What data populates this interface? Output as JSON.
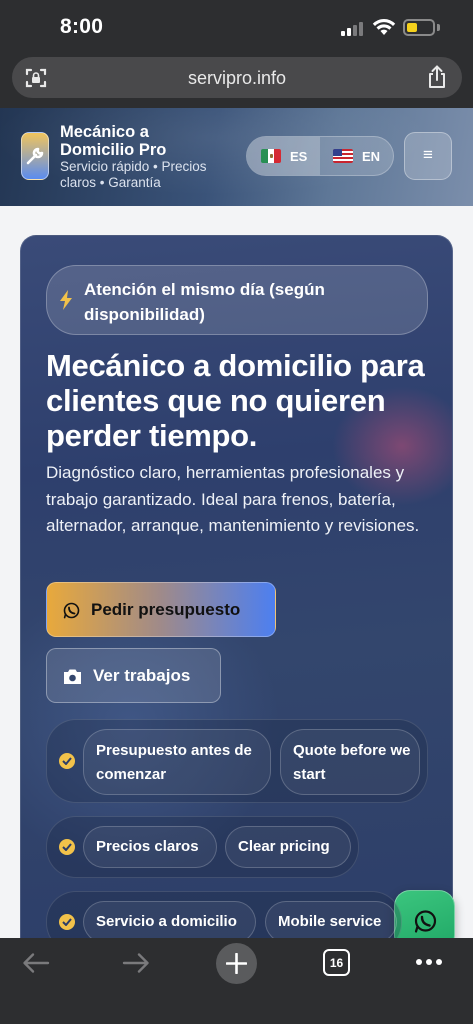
{
  "status_bar": {
    "time": "8:00"
  },
  "browser": {
    "url": "servipro.info",
    "tab_count": "16"
  },
  "header": {
    "brand_name": "Mecánico a Domicilio Pro",
    "brand_tagline": "Servicio rápido • Precios claros • Garantía",
    "lang_es": "ES",
    "lang_en": "EN",
    "menu_icon": "≡"
  },
  "hero": {
    "badge": "Atención el mismo día (según disponibilidad)",
    "title": "Mecánico a domicilio para clientes que no quieren perder tiempo.",
    "description": "Diagnóstico claro, herramientas profesionales y trabajo garantizado. Ideal para frenos, batería, alternador, arranque, mantenimiento y revisiones.",
    "btn_quote": "Pedir presupuesto",
    "btn_works": "Ver trabajos",
    "features": [
      {
        "es": "Presupuesto antes de comenzar",
        "en": "Quote before we start"
      },
      {
        "es": "Precios claros",
        "en": "Clear pricing"
      },
      {
        "es": "Servicio a domicilio",
        "en": "Mobile service"
      }
    ]
  },
  "icons": [
    "lock-icon",
    "share-icon",
    "wrench-icon",
    "flag-mexico-icon",
    "flag-us-icon",
    "menu-icon",
    "lightning-icon",
    "whatsapp-icon",
    "camera-icon",
    "check-icon",
    "phone-icon",
    "back-arrow-icon",
    "forward-arrow-icon",
    "plus-icon",
    "tabs-icon",
    "more-icon"
  ],
  "colors": {
    "accent_gold": "#f2c24a",
    "accent_blue": "#4d7ff0",
    "whatsapp_green": "#25b36e"
  }
}
